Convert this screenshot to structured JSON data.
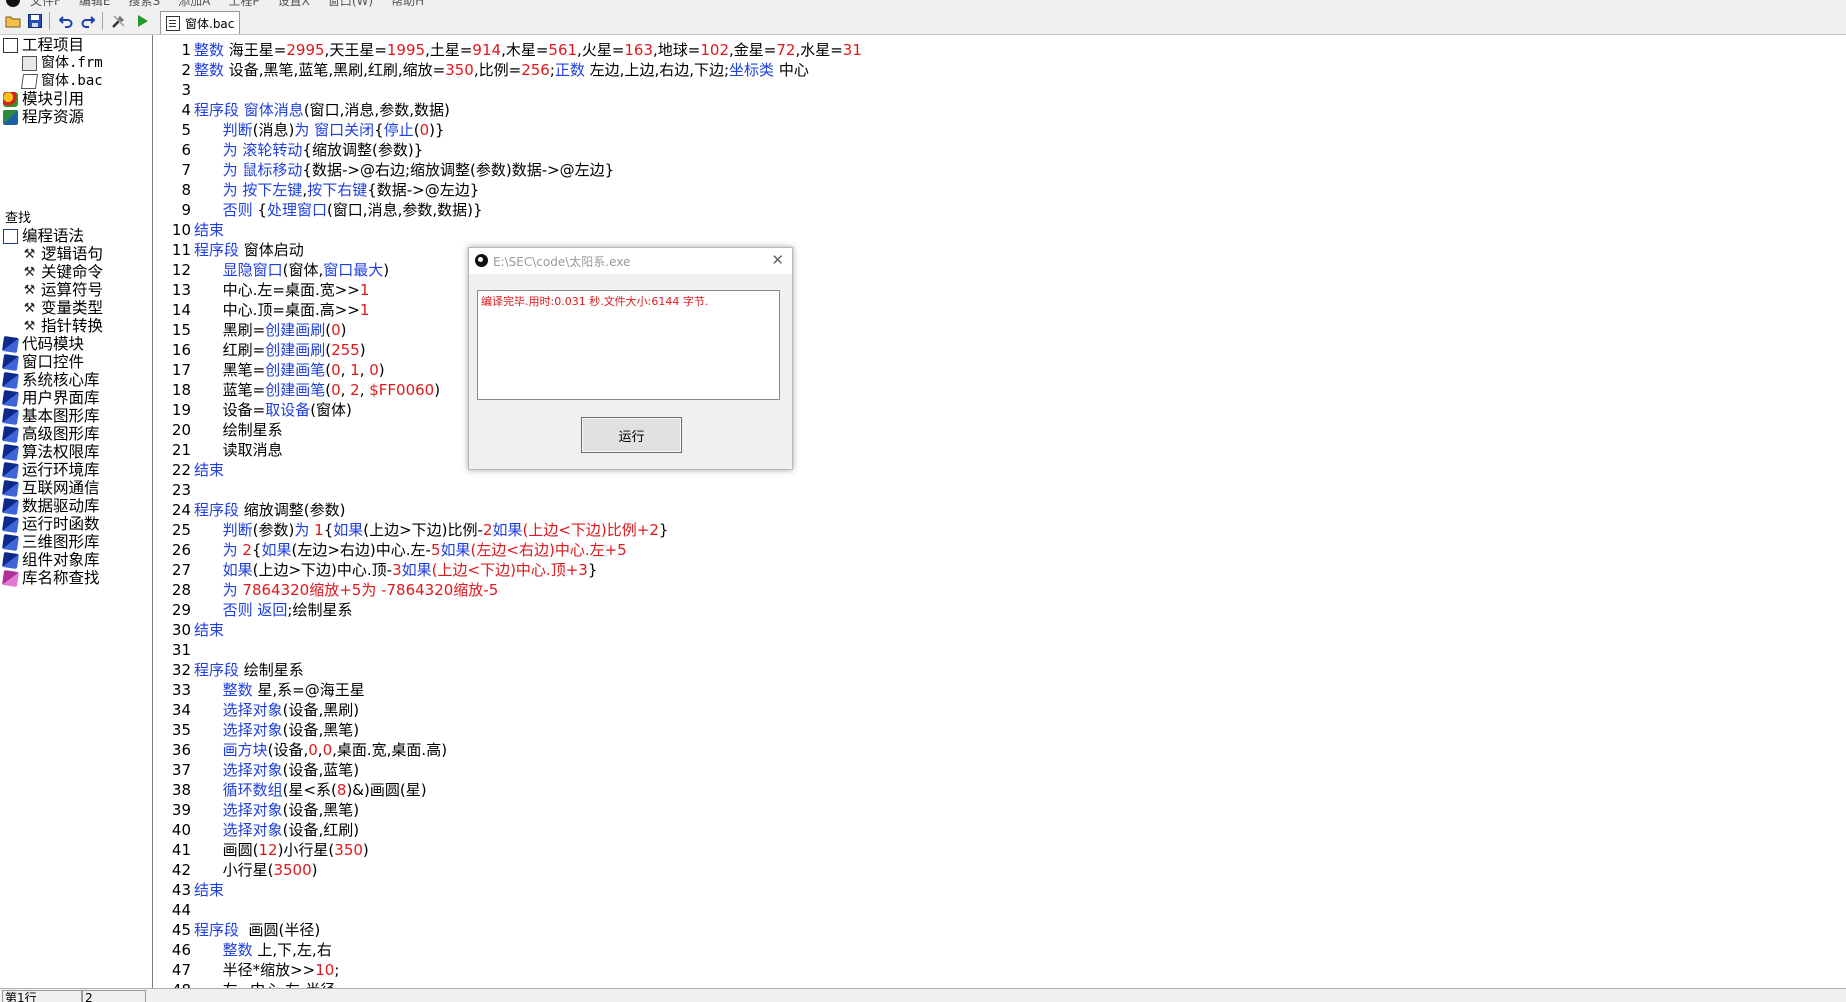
{
  "menu": [
    "文件F",
    "编辑E",
    "搜索S",
    "添加A",
    "工程P",
    "设置X",
    "窗口(W)",
    "帮助H"
  ],
  "toolbar": {
    "tab_label": "窗体.bac",
    "icons": [
      "open-folder-icon",
      "save-icon",
      "undo-icon",
      "redo-icon",
      "build-tools-icon",
      "run-icon"
    ]
  },
  "tree": {
    "project": "工程项目",
    "files": [
      "窗体.frm",
      "窗体.bac"
    ],
    "module_ref": "模块引用",
    "resources": "程序资源",
    "search_heading": "查找",
    "syntax": "编程语法",
    "syntax_items": [
      "逻辑语句",
      "关键命令",
      "运算符号",
      "变量类型",
      "指针转换"
    ],
    "libraries": [
      "代码模块",
      "窗口控件",
      "系统核心库",
      "用户界面库",
      "基本图形库",
      "高级图形库",
      "算法权限库",
      "运行环境库",
      "互联网通信",
      "数据驱动库",
      "运行时函数",
      "三维图形库",
      "组件对象库"
    ],
    "lib_search": "库名称查找"
  },
  "code_lines": [
    {
      "n": "1",
      "seg": [
        [
          "k",
          "整数"
        ],
        [
          "t",
          " 海王星="
        ],
        [
          "n",
          "2995"
        ],
        [
          "t",
          ",天王星="
        ],
        [
          "n",
          "1995"
        ],
        [
          "t",
          ",土星="
        ],
        [
          "n",
          "914"
        ],
        [
          "t",
          ",木星="
        ],
        [
          "n",
          "561"
        ],
        [
          "t",
          ",火星="
        ],
        [
          "n",
          "163"
        ],
        [
          "t",
          ",地球="
        ],
        [
          "n",
          "102"
        ],
        [
          "t",
          ",金星="
        ],
        [
          "n",
          "72"
        ],
        [
          "t",
          ",水星="
        ],
        [
          "n",
          "31"
        ]
      ]
    },
    {
      "n": "2",
      "seg": [
        [
          "k",
          "整数"
        ],
        [
          "t",
          " 设备,黑笔,蓝笔,黑刷,红刷,缩放="
        ],
        [
          "n",
          "350"
        ],
        [
          "t",
          ",比例="
        ],
        [
          "n",
          "256"
        ],
        [
          "t",
          ";"
        ],
        [
          "k",
          "正数"
        ],
        [
          "t",
          " 左边,上边,右边,下边;"
        ],
        [
          "k",
          "坐标类"
        ],
        [
          "t",
          " 中心"
        ]
      ]
    },
    {
      "n": "3",
      "seg": []
    },
    {
      "n": "4",
      "seg": [
        [
          "k",
          "程序段"
        ],
        [
          "t",
          " "
        ],
        [
          "k",
          "窗体消息"
        ],
        [
          "t",
          "(窗口,消息,参数,数据)"
        ]
      ]
    },
    {
      "n": "5",
      "seg": [
        [
          "t",
          "      "
        ],
        [
          "k",
          "判断"
        ],
        [
          "t",
          "(消息)"
        ],
        [
          "k",
          "为"
        ],
        [
          "t",
          " "
        ],
        [
          "k",
          "窗口关闭"
        ],
        [
          "t",
          "{"
        ],
        [
          "k",
          "停止"
        ],
        [
          "t",
          "("
        ],
        [
          "n",
          "0"
        ],
        [
          "t",
          ")}"
        ]
      ]
    },
    {
      "n": "6",
      "seg": [
        [
          "t",
          "      "
        ],
        [
          "k",
          "为"
        ],
        [
          "t",
          " "
        ],
        [
          "k",
          "滚轮转动"
        ],
        [
          "t",
          "{缩放调整(参数)}"
        ]
      ]
    },
    {
      "n": "7",
      "seg": [
        [
          "t",
          "      "
        ],
        [
          "k",
          "为"
        ],
        [
          "t",
          " "
        ],
        [
          "k",
          "鼠标移动"
        ],
        [
          "t",
          "{数据->@右边;缩放调整(参数)数据->@左边}"
        ]
      ]
    },
    {
      "n": "8",
      "seg": [
        [
          "t",
          "      "
        ],
        [
          "k",
          "为"
        ],
        [
          "t",
          " "
        ],
        [
          "k",
          "按下左键"
        ],
        [
          "t",
          ","
        ],
        [
          "k",
          "按下右键"
        ],
        [
          "t",
          "{数据->@左边}"
        ]
      ]
    },
    {
      "n": "9",
      "seg": [
        [
          "t",
          "      "
        ],
        [
          "k",
          "否则"
        ],
        [
          "t",
          " {"
        ],
        [
          "k",
          "处理窗口"
        ],
        [
          "t",
          "(窗口,消息,参数,数据)}"
        ]
      ]
    },
    {
      "n": "10",
      "seg": [
        [
          "k",
          "结束"
        ]
      ]
    },
    {
      "n": "11",
      "seg": [
        [
          "k",
          "程序段"
        ],
        [
          "t",
          " 窗体启动"
        ]
      ]
    },
    {
      "n": "12",
      "seg": [
        [
          "t",
          "      "
        ],
        [
          "k",
          "显隐窗口"
        ],
        [
          "t",
          "(窗体,"
        ],
        [
          "k",
          "窗口最大"
        ],
        [
          "t",
          ")"
        ]
      ]
    },
    {
      "n": "13",
      "seg": [
        [
          "t",
          "      中心.左=桌面.宽>>"
        ],
        [
          "n",
          "1"
        ]
      ]
    },
    {
      "n": "14",
      "seg": [
        [
          "t",
          "      中心.顶=桌面.高>>"
        ],
        [
          "n",
          "1"
        ]
      ]
    },
    {
      "n": "15",
      "seg": [
        [
          "t",
          "      黑刷="
        ],
        [
          "k",
          "创建画刷"
        ],
        [
          "t",
          "("
        ],
        [
          "n",
          "0"
        ],
        [
          "t",
          ")"
        ]
      ]
    },
    {
      "n": "16",
      "seg": [
        [
          "t",
          "      红刷="
        ],
        [
          "k",
          "创建画刷"
        ],
        [
          "t",
          "("
        ],
        [
          "n",
          "255"
        ],
        [
          "t",
          ")"
        ]
      ]
    },
    {
      "n": "17",
      "seg": [
        [
          "t",
          "      黑笔="
        ],
        [
          "k",
          "创建画笔"
        ],
        [
          "t",
          "("
        ],
        [
          "n",
          "0"
        ],
        [
          "t",
          ", "
        ],
        [
          "n",
          "1"
        ],
        [
          "t",
          ", "
        ],
        [
          "n",
          "0"
        ],
        [
          "t",
          ")"
        ]
      ]
    },
    {
      "n": "18",
      "seg": [
        [
          "t",
          "      蓝笔="
        ],
        [
          "k",
          "创建画笔"
        ],
        [
          "t",
          "("
        ],
        [
          "n",
          "0"
        ],
        [
          "t",
          ", "
        ],
        [
          "n",
          "2"
        ],
        [
          "t",
          ", "
        ],
        [
          "n",
          "$FF0060"
        ],
        [
          "t",
          ")"
        ]
      ]
    },
    {
      "n": "19",
      "seg": [
        [
          "t",
          "      设备="
        ],
        [
          "k",
          "取设备"
        ],
        [
          "t",
          "(窗体)"
        ]
      ]
    },
    {
      "n": "20",
      "seg": [
        [
          "t",
          "      绘制星系"
        ]
      ]
    },
    {
      "n": "21",
      "seg": [
        [
          "t",
          "      读取消息"
        ]
      ]
    },
    {
      "n": "22",
      "seg": [
        [
          "k",
          "结束"
        ]
      ]
    },
    {
      "n": "23",
      "seg": []
    },
    {
      "n": "24",
      "seg": [
        [
          "k",
          "程序段"
        ],
        [
          "t",
          " 缩放调整(参数)"
        ]
      ]
    },
    {
      "n": "25",
      "seg": [
        [
          "t",
          "      "
        ],
        [
          "k",
          "判断"
        ],
        [
          "t",
          "(参数)"
        ],
        [
          "k",
          "为"
        ],
        [
          "t",
          " "
        ],
        [
          "n",
          "1"
        ],
        [
          "t",
          "{"
        ],
        [
          "k",
          "如果"
        ],
        [
          "t",
          "(上边>下边)比例-"
        ],
        [
          "n",
          "2"
        ],
        [
          "k",
          "如果"
        ],
        [
          "n",
          "(上边<下边)比例+2"
        ],
        [
          "t",
          "}"
        ]
      ]
    },
    {
      "n": "26",
      "seg": [
        [
          "t",
          "      "
        ],
        [
          "k",
          "为"
        ],
        [
          "t",
          " "
        ],
        [
          "n",
          "2"
        ],
        [
          "t",
          "{"
        ],
        [
          "k",
          "如果"
        ],
        [
          "t",
          "(左边>右边)中心.左-"
        ],
        [
          "n",
          "5"
        ],
        [
          "k",
          "如果"
        ],
        [
          "n",
          "(左边<右边)中心.左+5"
        ]
      ]
    },
    {
      "n": "27",
      "seg": [
        [
          "t",
          "      "
        ],
        [
          "k",
          "如果"
        ],
        [
          "t",
          "(上边>下边)中心.顶-"
        ],
        [
          "n",
          "3"
        ],
        [
          "k",
          "如果"
        ],
        [
          "n",
          "(上边<下边)中心.顶+3"
        ],
        [
          "t",
          "}"
        ]
      ]
    },
    {
      "n": "28",
      "seg": [
        [
          "t",
          "      "
        ],
        [
          "k",
          "为"
        ],
        [
          "t",
          " "
        ],
        [
          "n",
          "7864320缩放+5为 -7864320缩放-5"
        ]
      ]
    },
    {
      "n": "29",
      "seg": [
        [
          "t",
          "      "
        ],
        [
          "k",
          "否则"
        ],
        [
          "t",
          " "
        ],
        [
          "k",
          "返回"
        ],
        [
          "t",
          ";绘制星系"
        ]
      ]
    },
    {
      "n": "30",
      "seg": [
        [
          "k",
          "结束"
        ]
      ]
    },
    {
      "n": "31",
      "seg": []
    },
    {
      "n": "32",
      "seg": [
        [
          "k",
          "程序段"
        ],
        [
          "t",
          " 绘制星系"
        ]
      ]
    },
    {
      "n": "33",
      "seg": [
        [
          "t",
          "      "
        ],
        [
          "k",
          "整数"
        ],
        [
          "t",
          " 星,系=@海王星"
        ]
      ]
    },
    {
      "n": "34",
      "seg": [
        [
          "t",
          "      "
        ],
        [
          "k",
          "选择对象"
        ],
        [
          "t",
          "(设备,黑刷)"
        ]
      ]
    },
    {
      "n": "35",
      "seg": [
        [
          "t",
          "      "
        ],
        [
          "k",
          "选择对象"
        ],
        [
          "t",
          "(设备,黑笔)"
        ]
      ]
    },
    {
      "n": "36",
      "seg": [
        [
          "t",
          "      "
        ],
        [
          "k",
          "画方块"
        ],
        [
          "t",
          "(设备,"
        ],
        [
          "n",
          "0"
        ],
        [
          "t",
          ","
        ],
        [
          "n",
          "0"
        ],
        [
          "t",
          ",桌面.宽,桌面.高)"
        ]
      ]
    },
    {
      "n": "37",
      "seg": [
        [
          "t",
          "      "
        ],
        [
          "k",
          "选择对象"
        ],
        [
          "t",
          "(设备,蓝笔)"
        ]
      ]
    },
    {
      "n": "38",
      "seg": [
        [
          "t",
          "      "
        ],
        [
          "k",
          "循环数组"
        ],
        [
          "t",
          "(星<系("
        ],
        [
          "n",
          "8"
        ],
        [
          "t",
          ")&)画圆(星)"
        ]
      ]
    },
    {
      "n": "39",
      "seg": [
        [
          "t",
          "      "
        ],
        [
          "k",
          "选择对象"
        ],
        [
          "t",
          "(设备,黑笔)"
        ]
      ]
    },
    {
      "n": "40",
      "seg": [
        [
          "t",
          "      "
        ],
        [
          "k",
          "选择对象"
        ],
        [
          "t",
          "(设备,红刷)"
        ]
      ]
    },
    {
      "n": "41",
      "seg": [
        [
          "t",
          "      画圆("
        ],
        [
          "n",
          "12"
        ],
        [
          "t",
          ")小行星("
        ],
        [
          "n",
          "350"
        ],
        [
          "t",
          ")"
        ]
      ]
    },
    {
      "n": "42",
      "seg": [
        [
          "t",
          "      小行星("
        ],
        [
          "n",
          "3500"
        ],
        [
          "t",
          ")"
        ]
      ]
    },
    {
      "n": "43",
      "seg": [
        [
          "k",
          "结束"
        ]
      ]
    },
    {
      "n": "44",
      "seg": []
    },
    {
      "n": "45",
      "seg": [
        [
          "k",
          "程序段"
        ],
        [
          "t",
          "  画圆(半径)"
        ]
      ]
    },
    {
      "n": "46",
      "seg": [
        [
          "t",
          "      "
        ],
        [
          "k",
          "整数"
        ],
        [
          "t",
          " 上,下,左,右"
        ]
      ]
    },
    {
      "n": "47",
      "seg": [
        [
          "t",
          "      半径*缩放>>"
        ],
        [
          "n",
          "10"
        ],
        [
          "t",
          ";"
        ]
      ]
    },
    {
      "n": "48",
      "seg": [
        [
          "t",
          "      左=中心.左-半径"
        ]
      ]
    }
  ],
  "popup": {
    "title": "E:\\SEC\\code\\太阳系.exe",
    "output": "编译完毕.用时:0.031 秒.文件大小:6144 字节.",
    "run_button": "运行",
    "close_glyph": "✕"
  },
  "status": {
    "line": "第1行",
    "col": "2"
  },
  "colors": {
    "keyword": "#1f3fe0",
    "number": "#e0181c",
    "text": "#000000"
  }
}
